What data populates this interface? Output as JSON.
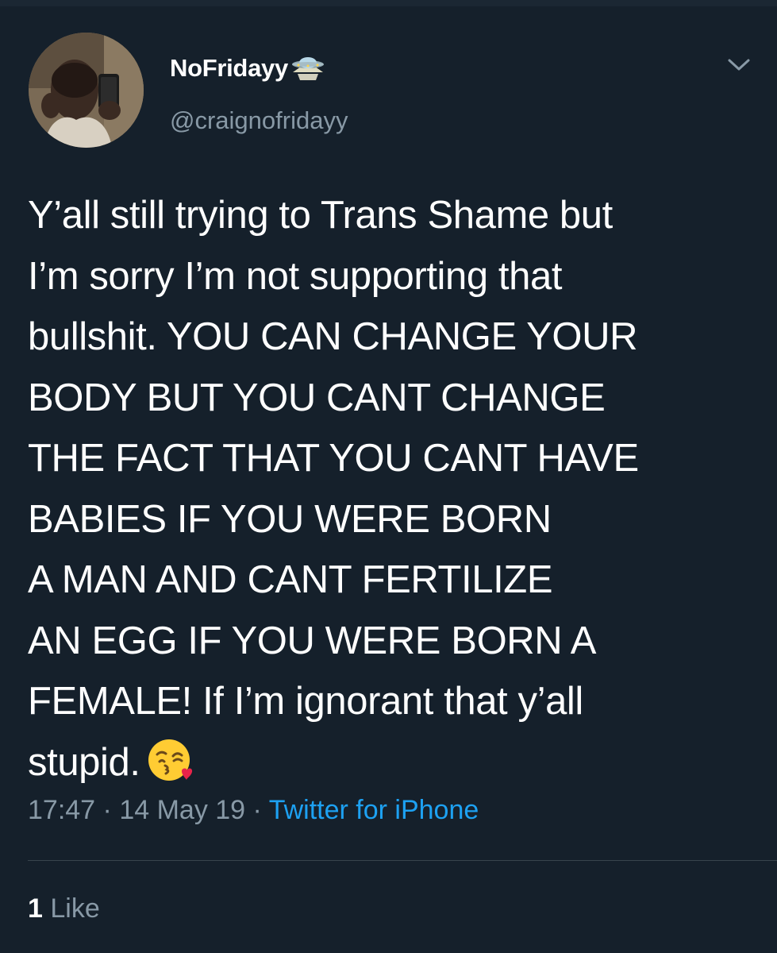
{
  "tweet": {
    "author": {
      "display_name": "NoFridayy",
      "handle": "@craignofridayy",
      "name_emoji": "ufo-icon"
    },
    "text_lines": [
      "Y’all still trying to Trans Shame but",
      "I’m sorry I’m not supporting that",
      "bullshit. YOU CAN CHANGE YOUR",
      "BODY BUT YOU CANT CHANGE",
      "THE FACT THAT YOU CANT HAVE",
      "BABIES IF YOU WERE BORN",
      "A MAN AND CANT FERTILIZE",
      "AN EGG IF YOU WERE BORN A",
      "FEMALE! If I’m ignorant that y’all",
      "stupid."
    ],
    "end_emoji": "kissing-face-with-heart-icon",
    "time": "17:47",
    "date": "14 May 19",
    "separator": "·",
    "source": "Twitter for iPhone",
    "likes": {
      "count": "1",
      "label": "Like"
    }
  },
  "colors": {
    "background": "#15202b",
    "text": "#ffffff",
    "secondary": "#8899a6",
    "link": "#1da1f2",
    "divider": "#38444d"
  }
}
